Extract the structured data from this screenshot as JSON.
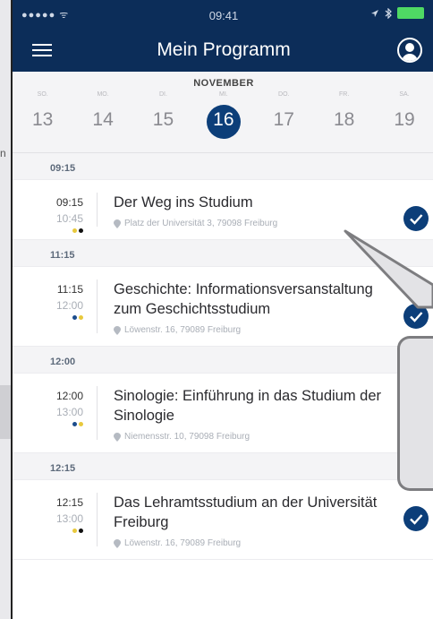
{
  "status_bar": {
    "signal": "●●●●● ᯤ",
    "time": "09:41",
    "icons": [
      "location-arrow-icon",
      "bluetooth-icon",
      "battery-icon"
    ]
  },
  "nav": {
    "title": "Mein Programm",
    "menu_icon": "hamburger-menu-icon",
    "profile_icon": "profile-icon"
  },
  "calendar": {
    "month": "NOVEMBER",
    "days": [
      {
        "dow": "SO.",
        "num": "13",
        "selected": false
      },
      {
        "dow": "MO.",
        "num": "14",
        "selected": false
      },
      {
        "dow": "DI.",
        "num": "15",
        "selected": false
      },
      {
        "dow": "MI.",
        "num": "16",
        "selected": true
      },
      {
        "dow": "DO.",
        "num": "17",
        "selected": false
      },
      {
        "dow": "FR.",
        "num": "18",
        "selected": false
      },
      {
        "dow": "SA.",
        "num": "19",
        "selected": false
      }
    ]
  },
  "sections": [
    {
      "header": "09:15",
      "event": {
        "start": "09:15",
        "end": "10:45",
        "title": "Der Weg ins Studium",
        "location": "Platz der Universität 3, 79098 Freiburg",
        "dots": [
          "#e8c93d",
          "#111111"
        ],
        "checked": true
      }
    },
    {
      "header": "11:15",
      "event": {
        "start": "11:15",
        "end": "12:00",
        "title": "Geschichte: Informationsversanstaltung zum Geschichtsstudium",
        "location": "Löwenstr. 16, 79089 Freiburg",
        "dots": [
          "#1b4c8c",
          "#e8c93d"
        ],
        "checked": true
      }
    },
    {
      "header": "12:00",
      "event": {
        "start": "12:00",
        "end": "13:00",
        "title": "Sinologie: Einführung in das Studium der Sinologie",
        "location": "Niemensstr. 10, 79098 Freiburg",
        "dots": [
          "#1b4c8c",
          "#e8c93d"
        ],
        "checked": true
      }
    },
    {
      "header": "12:15",
      "event": {
        "start": "12:15",
        "end": "13:00",
        "title": "Das Lehramtsstudium an der Universität Freiburg",
        "location": "Löwenstr. 16, 79089 Freiburg",
        "dots": [
          "#e8c93d",
          "#111111"
        ],
        "checked": true
      }
    }
  ],
  "background": {
    "left_text": "n"
  },
  "colors": {
    "nav_bg": "#0c2d59",
    "accent": "#0c3e79",
    "dot_yellow": "#e8c93d",
    "dot_blue": "#1b4c8c",
    "dot_black": "#111111"
  }
}
